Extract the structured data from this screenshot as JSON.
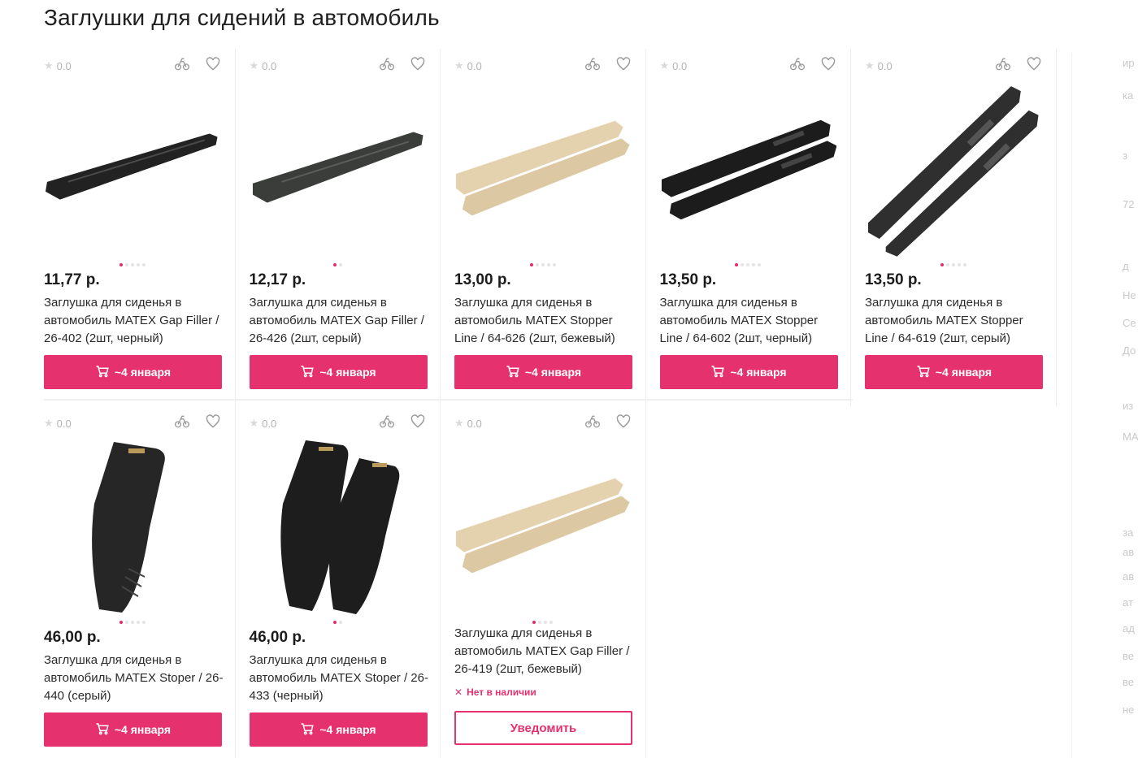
{
  "page_title": "Заглушки для сидений в автомобиль",
  "colors": {
    "accent": "#e5326e",
    "text": "#222222",
    "muted": "#b3b3b3"
  },
  "products": [
    {
      "rating": "0.0",
      "price": "11,77 р.",
      "title": "Заглушка для сиденья в автомобиль MATEX Gap Filler / 26-402 (2шт, черный)",
      "button": "~4 января",
      "dots": 5,
      "active_dot": 0,
      "image": "single-black"
    },
    {
      "rating": "0.0",
      "price": "12,17 р.",
      "title": "Заглушка для сиденья в автомобиль MATEX Gap Filler / 26-426 (2шт, серый)",
      "button": "~4 января",
      "dots": 2,
      "active_dot": 0,
      "image": "single-darkgray"
    },
    {
      "rating": "0.0",
      "price": "13,00 р.",
      "title": "Заглушка для сиденья в автомобиль MATEX Stopper Line / 64-626 (2шт, бежевый)",
      "button": "~4 января",
      "dots": 5,
      "active_dot": 0,
      "image": "pair-beige"
    },
    {
      "rating": "0.0",
      "price": "13,50 р.",
      "title": "Заглушка для сиденья в автомобиль MATEX Stopper Line / 64-602 (2шт, черный)",
      "button": "~4 января",
      "dots": 5,
      "active_dot": 0,
      "image": "pair-black"
    },
    {
      "rating": "0.0",
      "price": "13,50 р.",
      "title": "Заглушка для сиденья в автомобиль MATEX Stopper Line / 64-619 (2шт, серый)",
      "button": "~4 января",
      "dots": 5,
      "active_dot": 0,
      "image": "pair-gray-diagonal"
    },
    {
      "rating": "0.0",
      "price": "46,00 р.",
      "title": "Заглушка для сиденья в автомобиль MATEX Stoper / 26-440 (серый)",
      "button": "~4 января",
      "dots": 5,
      "active_dot": 0,
      "image": "wedge-single"
    },
    {
      "rating": "0.0",
      "price": "46,00 р.",
      "title": "Заглушка для сиденья в автомобиль MATEX Stoper / 26-433 (черный)",
      "button": "~4 января",
      "dots": 2,
      "active_dot": 0,
      "image": "wedge-pair"
    },
    {
      "rating": "0.0",
      "price": "",
      "title": "Заглушка для сиденья в автомобиль MATEX Gap Filler / 26-419 (2шт, бежевый)",
      "stock": "Нет в наличии",
      "button": "Уведомить",
      "dots": 4,
      "active_dot": 0,
      "image": "pair-beige"
    }
  ],
  "side_fragments": [
    "ир",
    "ка",
    "з",
    "72",
    "д",
    "Не",
    "Се",
    "До",
    "из",
    "MA",
    "за",
    "ав",
    "ав",
    "ат",
    "ад",
    "ве",
    "ве",
    "не"
  ]
}
